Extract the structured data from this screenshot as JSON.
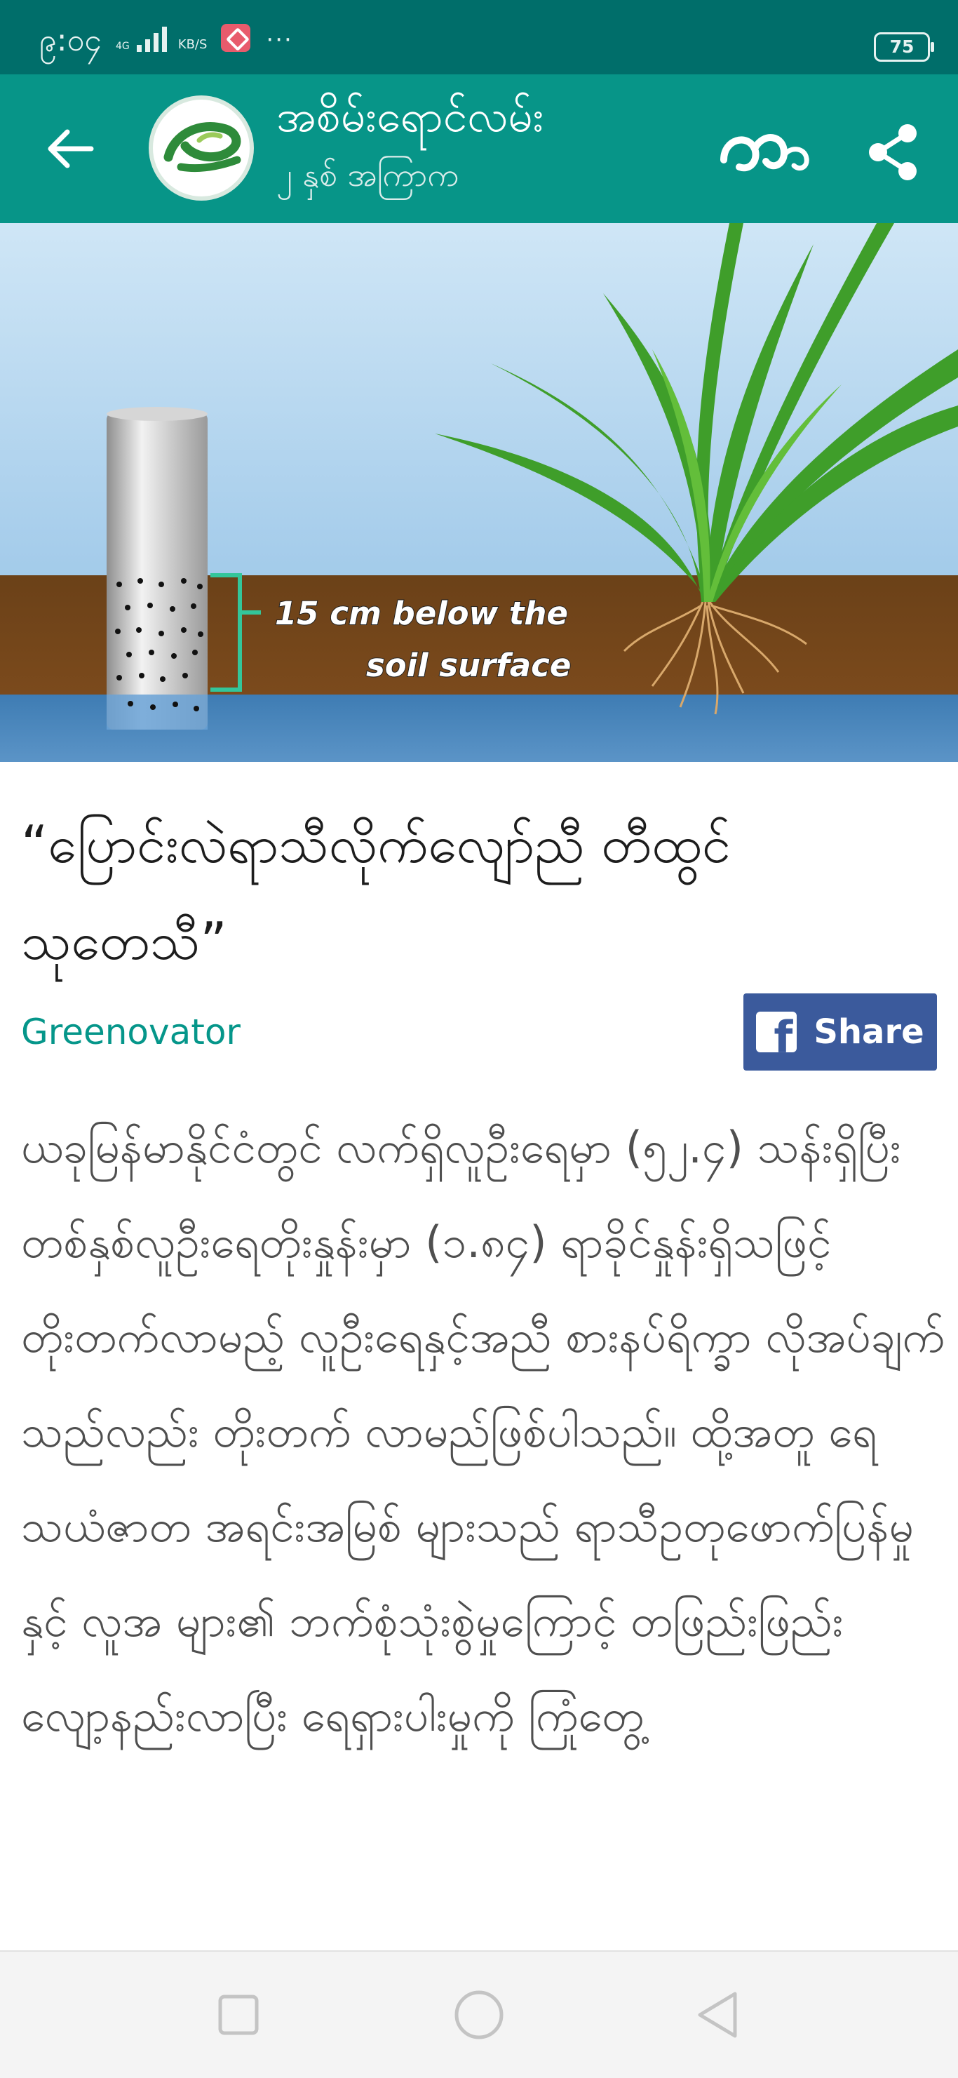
{
  "status_bar": {
    "time": "၉:၀၄",
    "network": "4G",
    "speed_unit": "KB/S",
    "more": "···",
    "battery": "75"
  },
  "header": {
    "channel_name": "အစိမ်းရောင်လမ်း",
    "posted": "၂ နှစ် အကြာက",
    "font_toggle": "ဣ"
  },
  "hero_image": {
    "caption_line1": "15 cm below the",
    "caption_line2": "soil surface"
  },
  "article": {
    "title": "“ပြောင်းလဲရာသီလိုက်လျော်ညီ တီထွင်သုတေသီ”",
    "author": "Greenovator",
    "share_label": "Share",
    "body": "ယခုမြန်မာနိုင်ငံတွင် လက်ရှိလူဦးရေမှာ (၅၂.၄) သန်းရှိပြီး တစ်နှစ်လူဦးရေတိုးနှုန်းမှာ (၁.၈၄) ရာခိုင်နှုန်းရှိသဖြင့် တိုးတက်လာမည့် လူဦးရေနှင့်အညီ စားနပ်ရိက္ခာ လိုအပ်ချက် သည်လည်း တိုးတက် လာမည်ဖြစ်ပါသည်။ ထို့အတူ ရေသယံဇာတ အရင်းအမြစ် များသည် ရာသီဥတုဖောက်ပြန်မှုနှင့် လူအ များ၏ ဘက်စုံသုံးစွဲမှုကြောင့် တဖြည်းဖြည်း လျော့နည်းလာပြီး ရေရှားပါးမှုကို ကြုံတွေ့"
  },
  "colors": {
    "status_bar": "#006e6a",
    "app_bar": "#079588",
    "accent": "#05968a",
    "facebook": "#3b5a9c"
  },
  "icons": {
    "back": "back-arrow-icon",
    "share": "share-icon",
    "facebook": "facebook-icon",
    "nav_recents": "square-icon",
    "nav_home": "circle-icon",
    "nav_back": "triangle-icon"
  }
}
